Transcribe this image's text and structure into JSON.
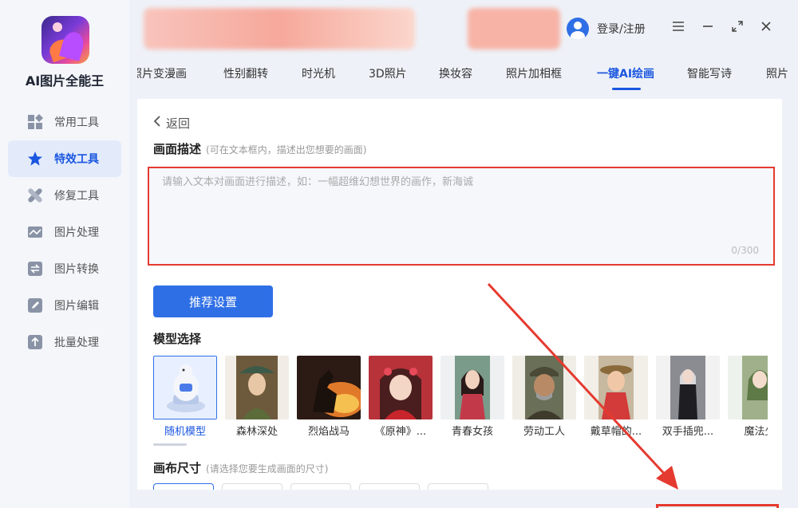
{
  "app": {
    "name": "AI图片全能王"
  },
  "sidebar": {
    "items": [
      {
        "label": "常用工具",
        "icon": "grid-icon",
        "active": false
      },
      {
        "label": "特效工具",
        "icon": "star-icon",
        "active": true
      },
      {
        "label": "修复工具",
        "icon": "bandage-icon",
        "active": false
      },
      {
        "label": "图片处理",
        "icon": "image-icon",
        "active": false
      },
      {
        "label": "图片转换",
        "icon": "convert-icon",
        "active": false
      },
      {
        "label": "图片编辑",
        "icon": "edit-icon",
        "active": false
      },
      {
        "label": "批量处理",
        "icon": "upload-icon",
        "active": false
      }
    ]
  },
  "header": {
    "login_label": "登录/注册"
  },
  "tabs": [
    {
      "label": "照片变漫画"
    },
    {
      "label": "性别翻转"
    },
    {
      "label": "时光机"
    },
    {
      "label": "3D照片"
    },
    {
      "label": "换妆容"
    },
    {
      "label": "照片加相框"
    },
    {
      "label": "一键AI绘画",
      "active": true
    },
    {
      "label": "智能写诗"
    },
    {
      "label": "照片"
    }
  ],
  "main": {
    "back_label": "返回",
    "description": {
      "title": "画面描述",
      "hint": "(可在文本框内，描述出您想要的画面)",
      "placeholder": "请输入文本对画面进行描述，如：一幅超维幻想世界的画作，新海诚",
      "counter": "0/300"
    },
    "recommend_button": "推荐设置",
    "model": {
      "title": "模型选择",
      "items": [
        {
          "label": "随机模型",
          "selected": true
        },
        {
          "label": "森林深处"
        },
        {
          "label": "烈焰战马"
        },
        {
          "label": "《原神》..."
        },
        {
          "label": "青春女孩"
        },
        {
          "label": "劳动工人"
        },
        {
          "label": "戴草帽的..."
        },
        {
          "label": "双手插兜..."
        },
        {
          "label": "魔法少"
        }
      ]
    },
    "canvas": {
      "title": "画布尺寸",
      "hint": "(请选择您要生成画面的尺寸)"
    }
  },
  "colors": {
    "accent": "#1a56e0",
    "annotation": "#e53a2f"
  }
}
